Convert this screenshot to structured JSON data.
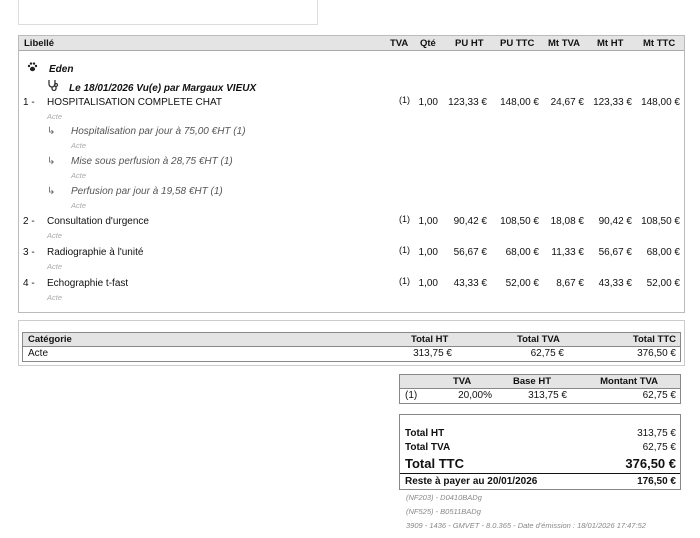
{
  "columns": {
    "libelle": "Libellé",
    "tva": "TVA",
    "qte": "Qté",
    "pu_ht": "PU HT",
    "pu_ttc": "PU TTC",
    "mt_tva": "Mt TVA",
    "mt_ht": "Mt HT",
    "mt_ttc": "Mt TTC"
  },
  "patient": {
    "name": "Eden",
    "icon": "paw-icon"
  },
  "visit": {
    "label": "Le 18/01/2026 Vu(e) par Margaux VIEUX",
    "icon": "stethoscope-icon"
  },
  "lines": [
    {
      "num": "1 -",
      "label": "HOSPITALISATION COMPLETE CHAT",
      "type": "Acte",
      "tva": "(1)",
      "qte": "1,00",
      "pu_ht": "123,33 €",
      "pu_ttc": "148,00 €",
      "mt_tva": "24,67 €",
      "mt_ht": "123,33 €",
      "mt_ttc": "148,00 €",
      "children": [
        {
          "label": "Hospitalisation par jour à 75,00 €HT (1)",
          "type": "Acte"
        },
        {
          "label": "Mise sous perfusion à 28,75 €HT (1)",
          "type": "Acte"
        },
        {
          "label": "Perfusion par jour à 19,58 €HT (1)",
          "type": "Acte"
        }
      ]
    },
    {
      "num": "2 -",
      "label": "Consultation d'urgence",
      "type": "Acte",
      "tva": "(1)",
      "qte": "1,00",
      "pu_ht": "90,42 €",
      "pu_ttc": "108,50 €",
      "mt_tva": "18,08 €",
      "mt_ht": "90,42 €",
      "mt_ttc": "108,50 €"
    },
    {
      "num": "3 -",
      "label": "Radiographie à l'unité",
      "type": "Acte",
      "tva": "(1)",
      "qte": "1,00",
      "pu_ht": "56,67 €",
      "pu_ttc": "68,00 €",
      "mt_tva": "11,33 €",
      "mt_ht": "56,67 €",
      "mt_ttc": "68,00 €"
    },
    {
      "num": "4 -",
      "label": "Echographie t-fast",
      "type": "Acte",
      "tva": "(1)",
      "qte": "1,00",
      "pu_ht": "43,33 €",
      "pu_ttc": "52,00 €",
      "mt_tva": "8,67 €",
      "mt_ht": "43,33 €",
      "mt_ttc": "52,00 €"
    }
  ],
  "category_table": {
    "headers": {
      "categorie": "Catégorie",
      "total_ht": "Total HT",
      "total_tva": "Total TVA",
      "total_ttc": "Total TTC"
    },
    "rows": [
      {
        "categorie": "Acte",
        "total_ht": "313,75 €",
        "total_tva": "62,75 €",
        "total_ttc": "376,50 €"
      }
    ]
  },
  "tva_table": {
    "headers": {
      "tva": "TVA",
      "base_ht": "Base HT",
      "montant_tva": "Montant TVA"
    },
    "rows": [
      {
        "code": "(1)",
        "rate": "20,00%",
        "base_ht": "313,75 €",
        "montant_tva": "62,75 €"
      }
    ]
  },
  "totals": {
    "total_ht_label": "Total HT",
    "total_ht": "313,75 €",
    "total_tva_label": "Total TVA",
    "total_tva": "62,75 €",
    "total_ttc_label": "Total TTC",
    "total_ttc": "376,50 €",
    "reste_label": "Reste à payer au 20/01/2026",
    "reste": "176,50 €"
  },
  "footer": {
    "line1": "(NF203) - D0410BADg",
    "line2": "(NF525) - B0511BADg",
    "line3": "3909 - 1436 - GMVET - 8.0.365 - Date d'émission : 18/01/2026 17:47:52"
  }
}
